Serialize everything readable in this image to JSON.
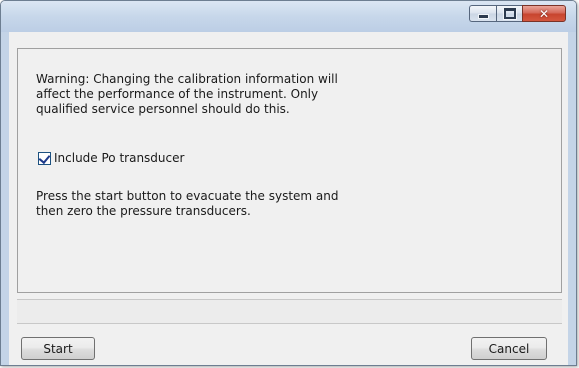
{
  "window": {
    "caption_buttons": {
      "minimize_icon": "minimize-icon",
      "maximize_icon": "maximize-icon",
      "close_icon": "close-icon",
      "close_glyph": "✕"
    }
  },
  "panel": {
    "warning_text": "Warning:  Changing the calibration information will\naffect the performance of the instrument. Only\nqualified service personnel should do this.",
    "checkbox": {
      "label": "Include Po transducer",
      "checked": true
    },
    "instruction_text": "Press the start button to evacuate the system and\nthen zero the pressure transducers."
  },
  "buttons": {
    "start_label": "Start",
    "cancel_label": "Cancel"
  },
  "colors": {
    "title_bar": "#c7d7ea",
    "close_button": "#c8452f",
    "frame": "#c4d4e7",
    "dialog_bg": "#f0f0f0"
  }
}
